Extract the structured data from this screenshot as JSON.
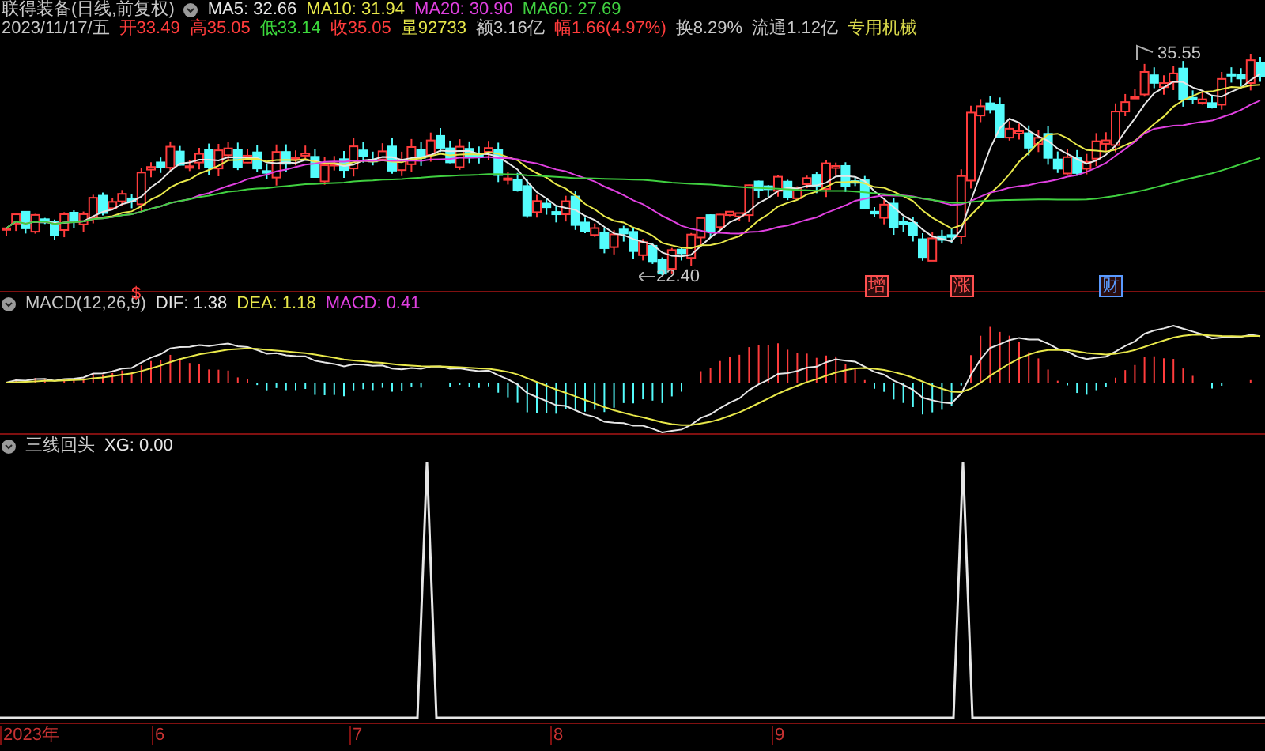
{
  "header": {
    "title": "联得装备(日线,前复权)",
    "ma_lines": [
      {
        "text": "MA5: 32.66",
        "color": "#e6e6e6"
      },
      {
        "text": "MA10: 31.94",
        "color": "#e8e84a"
      },
      {
        "text": "MA20: 30.90",
        "color": "#e040e0"
      },
      {
        "text": "MA60: 27.69",
        "color": "#40d040"
      }
    ],
    "date": "2023/11/17/五",
    "quote": [
      {
        "text": "开33.49",
        "color": "#ff3c3c"
      },
      {
        "text": "高35.05",
        "color": "#ff3c3c"
      },
      {
        "text": "低33.14",
        "color": "#3cd83c"
      },
      {
        "text": "收35.05",
        "color": "#ff3c3c"
      },
      {
        "text": "量92733",
        "color": "#e8e84a"
      },
      {
        "text": "额3.16亿",
        "color": "#c8c8c8"
      },
      {
        "text": "幅1.66(4.97%)",
        "color": "#ff3c3c"
      },
      {
        "text": "换8.29%",
        "color": "#c8c8c8"
      },
      {
        "text": "流通1.12亿",
        "color": "#c8c8c8"
      }
    ],
    "industry": "专用机械"
  },
  "price_chart": {
    "high_label": "35.55",
    "low_label": "22.40",
    "markers": [
      {
        "text": "$",
        "kind": "plain",
        "color": "#ff3c3c"
      },
      {
        "text": "增",
        "kind": "box",
        "color": "#ff5050"
      },
      {
        "text": "涨",
        "kind": "box",
        "color": "#ff5050"
      },
      {
        "text": "财",
        "kind": "box",
        "color": "#5a9aff"
      }
    ]
  },
  "macd": {
    "title": "MACD(12,26,9)",
    "items": [
      {
        "text": "DIF: 1.38",
        "color": "#e6e6e6"
      },
      {
        "text": "DEA: 1.18",
        "color": "#e8e84a"
      },
      {
        "text": "MACD: 0.41",
        "color": "#e040e0"
      }
    ]
  },
  "indicator": {
    "title": "三线回头",
    "items": [
      {
        "text": "XG: 0.00",
        "color": "#e6e6e6"
      }
    ]
  },
  "x_axis": {
    "labels": [
      "2023年",
      "6",
      "7",
      "8",
      "9"
    ]
  }
}
